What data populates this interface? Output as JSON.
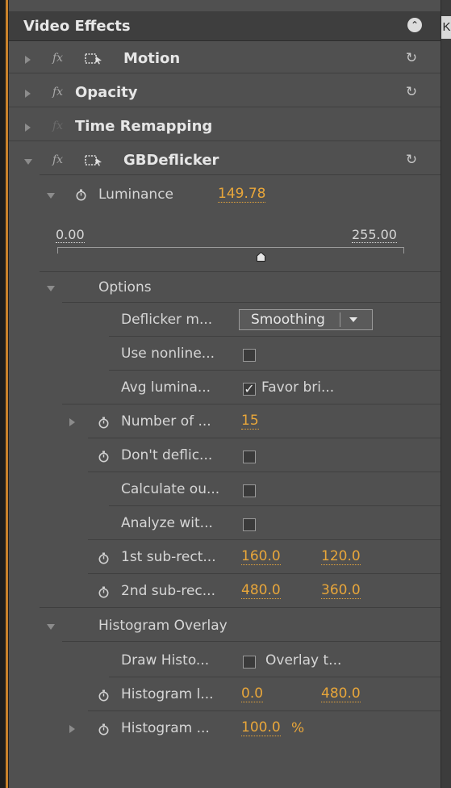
{
  "panel": {
    "title": "Video Effects",
    "right_tab_label": "K"
  },
  "effects": [
    {
      "name": "Motion",
      "fx": "fx",
      "expanded": false
    },
    {
      "name": "Opacity",
      "fx": "fx",
      "expanded": false
    },
    {
      "name": "Time Remapping",
      "fx": "fx",
      "expanded": false
    },
    {
      "name": "GBDeflicker",
      "fx": "fx",
      "expanded": true
    }
  ],
  "luminance": {
    "label": "Luminance",
    "value": "149.78",
    "slider_min": "0.00",
    "slider_max": "255.00",
    "slider_position": 0.587
  },
  "options": {
    "label": "Options",
    "deflicker_mode": {
      "label": "Deflicker m...",
      "selected": "Smoothing"
    },
    "use_nonlinear": {
      "label": "Use nonline...",
      "checked": false
    },
    "avg_luminance": {
      "label": "Avg lumina...",
      "checked": true,
      "checkbox_text": "Favor bri..."
    },
    "number_of": {
      "label": "Number of ...",
      "value": "15"
    },
    "dont_deflicker": {
      "label": "Don't deflic...",
      "checked": false
    },
    "calculate": {
      "label": "Calculate ou...",
      "checked": false
    },
    "analyze": {
      "label": "Analyze wit...",
      "checked": false
    },
    "sub_rect_1": {
      "label": "1st sub-rect...",
      "x": "160.0",
      "y": "120.0"
    },
    "sub_rect_2": {
      "label": "2nd sub-rec...",
      "x": "480.0",
      "y": "360.0"
    }
  },
  "histogram": {
    "label": "Histogram Overlay",
    "draw": {
      "label": "Draw Histo...",
      "checked": false,
      "checkbox_text": "Overlay t..."
    },
    "location": {
      "label": "Histogram l...",
      "x": "0.0",
      "y": "480.0"
    },
    "scale": {
      "label": "Histogram ...",
      "value": "100.0",
      "unit": "%"
    }
  },
  "colors": {
    "value_orange": "#e8a63a",
    "panel_bg": "#505050",
    "header_bg": "#3e3e3e",
    "accent_frame": "#c9822a"
  }
}
